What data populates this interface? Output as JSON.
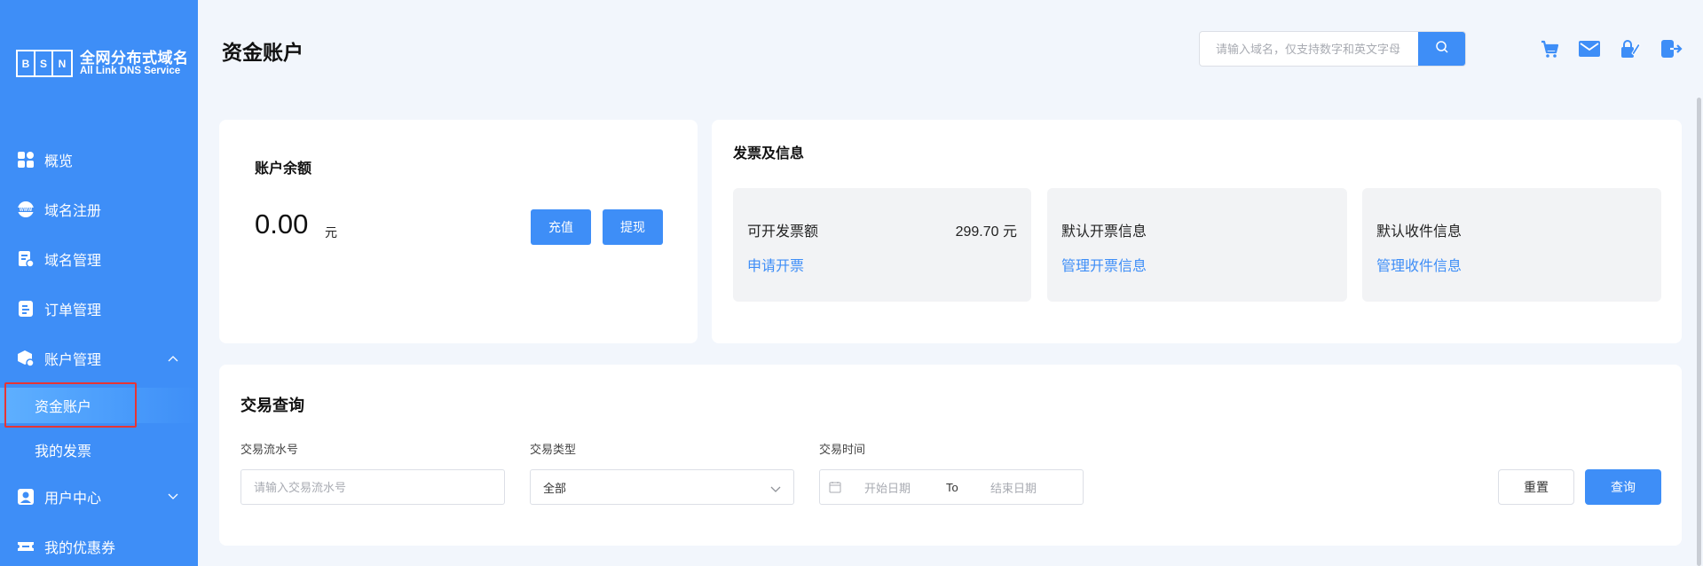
{
  "logo": {
    "letters": [
      "B",
      "S",
      "N"
    ],
    "title_cn": "全网分布式域名",
    "title_en": "All Link DNS Service"
  },
  "sidebar": {
    "items": [
      {
        "label": "概览",
        "icon": "grid-icon"
      },
      {
        "label": "域名注册",
        "icon": "www-icon"
      },
      {
        "label": "域名管理",
        "icon": "domain-manage-icon"
      },
      {
        "label": "订单管理",
        "icon": "order-icon"
      },
      {
        "label": "账户管理",
        "icon": "account-icon",
        "expanded": true
      },
      {
        "label": "用户中心",
        "icon": "user-icon",
        "expanded": false
      },
      {
        "label": "我的优惠券",
        "icon": "coupon-icon"
      }
    ],
    "sub_items": [
      {
        "label": "资金账户",
        "active": true
      },
      {
        "label": "我的发票",
        "active": false
      }
    ]
  },
  "header": {
    "title": "资金账户",
    "search_placeholder": "请输入域名，仅支持数字和英文字母",
    "icons": [
      "cart-icon",
      "mail-icon",
      "edit-lock-icon",
      "logout-icon"
    ]
  },
  "balance": {
    "title": "账户余额",
    "amount": "0.00",
    "unit": "元",
    "recharge_label": "充值",
    "withdraw_label": "提现"
  },
  "invoice": {
    "title": "发票及信息",
    "boxes": [
      {
        "label": "可开发票额",
        "value": "299.70 元",
        "link": "申请开票"
      },
      {
        "label": "默认开票信息",
        "value": "",
        "link": "管理开票信息"
      },
      {
        "label": "默认收件信息",
        "value": "",
        "link": "管理收件信息"
      }
    ]
  },
  "transactions": {
    "title": "交易查询",
    "serial_label": "交易流水号",
    "serial_placeholder": "请输入交易流水号",
    "type_label": "交易类型",
    "type_value": "全部",
    "time_label": "交易时间",
    "start_placeholder": "开始日期",
    "range_sep": "To",
    "end_placeholder": "结束日期",
    "reset_label": "重置",
    "query_label": "查询"
  },
  "colors": {
    "primary": "#3e8ef7",
    "highlight": "#e63535",
    "background": "#f2f6fc"
  }
}
